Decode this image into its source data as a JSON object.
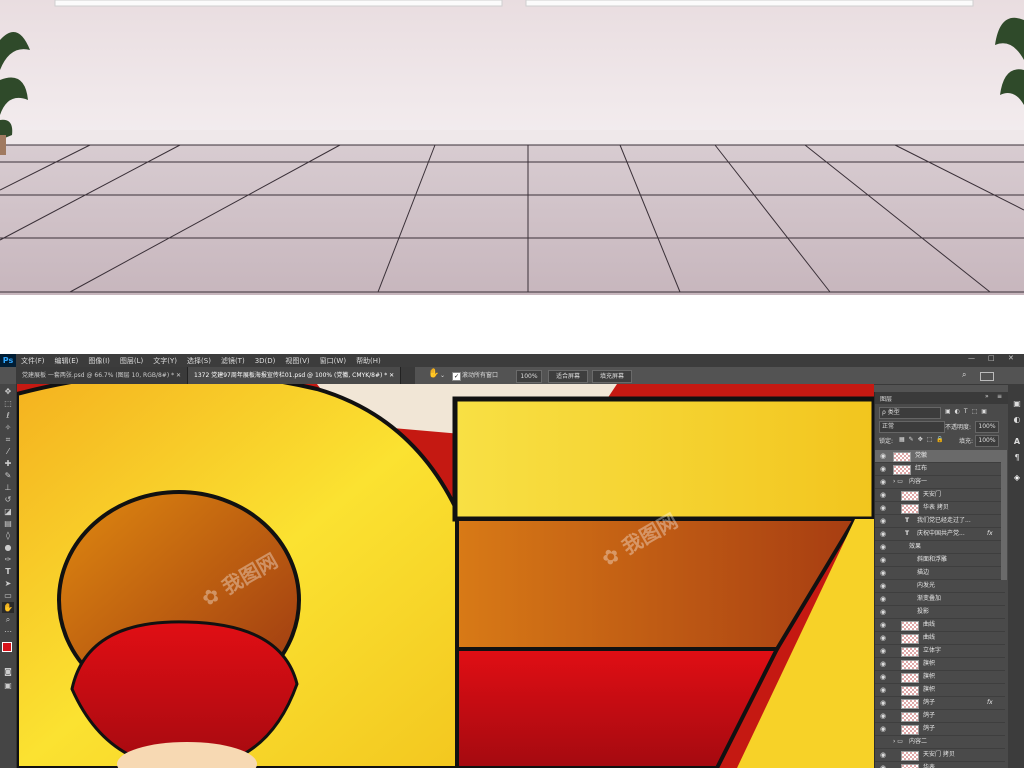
{
  "menubar": {
    "logo": "Ps",
    "items": [
      "文件(F)",
      "编辑(E)",
      "图像(I)",
      "图层(L)",
      "文字(Y)",
      "选择(S)",
      "滤镜(T)",
      "3D(D)",
      "视图(V)",
      "窗口(W)",
      "帮助(H)"
    ],
    "window_controls": [
      "—",
      "□",
      "✕"
    ]
  },
  "tabs": [
    {
      "label": "党建展板 一套两张.psd @ 66.7% (图层 10, RGB/8#) *  ✕",
      "active": false
    },
    {
      "label": "1372 党建97周年展板海报宣传栏01.psd @ 100% (党徽, CMYK/8#) *  ✕",
      "active": true
    }
  ],
  "options": {
    "scroll_all_label": "滚动所有窗口",
    "zoom_value": "100%",
    "fit_screen": "适合屏幕",
    "fill_screen": "填充屏幕"
  },
  "layers_panel": {
    "title": "图层",
    "filter_label": "ρ 类型",
    "blend_mode": "正常",
    "opacity_label": "不透明度:",
    "opacity_value": "100%",
    "lock_label": "锁定:",
    "fill_label": "填充:",
    "fill_value": "100%",
    "layers": [
      {
        "name": "党徽",
        "kind": "pixel",
        "indent": 0,
        "selected": true,
        "visible": true
      },
      {
        "name": "红布",
        "kind": "pixel",
        "indent": 0,
        "visible": true
      },
      {
        "name": "内容一",
        "kind": "group",
        "indent": 0,
        "visible": true
      },
      {
        "name": "天安门",
        "kind": "pixel",
        "indent": 1,
        "visible": true
      },
      {
        "name": "华表 拷贝",
        "kind": "pixel",
        "indent": 1,
        "visible": true
      },
      {
        "name": "我们党已经走过了...",
        "kind": "text",
        "indent": 1,
        "visible": true
      },
      {
        "name": "庆祝中国共产党...",
        "kind": "text",
        "indent": 1,
        "visible": true,
        "fx": "fx"
      },
      {
        "name": "效果",
        "kind": "effects",
        "indent": 2,
        "visible": true
      },
      {
        "name": "斜面和浮雕",
        "kind": "effect",
        "indent": 3,
        "visible": true
      },
      {
        "name": "描边",
        "kind": "effect",
        "indent": 3,
        "visible": true
      },
      {
        "name": "内发光",
        "kind": "effect",
        "indent": 3,
        "visible": true
      },
      {
        "name": "渐变叠加",
        "kind": "effect",
        "indent": 3,
        "visible": true
      },
      {
        "name": "投影",
        "kind": "effect",
        "indent": 3,
        "visible": true
      },
      {
        "name": "曲线",
        "kind": "pixel",
        "indent": 1,
        "visible": true
      },
      {
        "name": "曲线",
        "kind": "pixel",
        "indent": 1,
        "visible": true
      },
      {
        "name": "立体字",
        "kind": "pixel",
        "indent": 1,
        "visible": true
      },
      {
        "name": "旗帜",
        "kind": "pixel",
        "indent": 1,
        "visible": true
      },
      {
        "name": "旗帜",
        "kind": "pixel",
        "indent": 1,
        "visible": true
      },
      {
        "name": "旗帜",
        "kind": "pixel",
        "indent": 1,
        "visible": true
      },
      {
        "name": "鸽子",
        "kind": "pixel",
        "indent": 1,
        "visible": true,
        "fx": "fx"
      },
      {
        "name": "鸽子",
        "kind": "pixel",
        "indent": 1,
        "visible": true
      },
      {
        "name": "鸽子",
        "kind": "pixel",
        "indent": 1,
        "visible": true
      },
      {
        "name": "内容二",
        "kind": "group",
        "indent": 0,
        "visible": false
      },
      {
        "name": "天安门 拷贝",
        "kind": "pixel",
        "indent": 1,
        "visible": true
      },
      {
        "name": "华表",
        "kind": "pixel",
        "indent": 1,
        "visible": true
      }
    ]
  },
  "colors": {
    "foreground": "#d9131b",
    "background": "#ffffff",
    "ps_accent": "#31a8ff"
  }
}
